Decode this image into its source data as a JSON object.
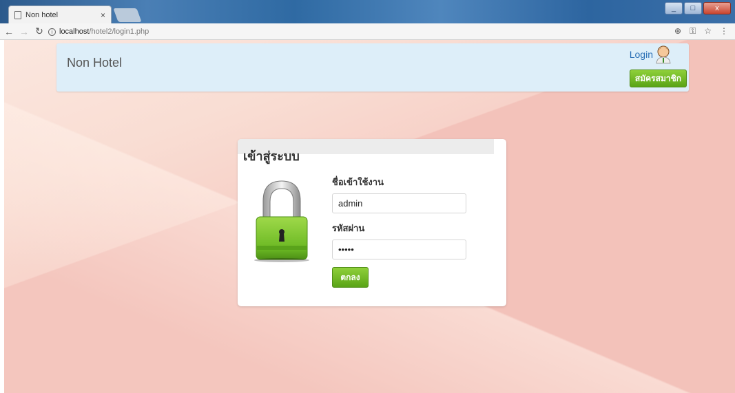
{
  "browser": {
    "tab_title": "Non hotel",
    "tab_close": "×",
    "url_host": "localhost",
    "url_path": "/hotel2/login1.php",
    "window_buttons": [
      "_",
      "□",
      "x"
    ],
    "toolbar_icons": [
      "zoom-icon",
      "key-icon",
      "star-icon",
      "menu-icon"
    ]
  },
  "header": {
    "brand": "Non Hotel",
    "login_label": "Login",
    "register_label": "สมัครสมาชิก"
  },
  "login_card": {
    "title": "เข้าสู่ระบบ",
    "username_label": "ชื่อเข้าใช้งาน",
    "username_value": "admin",
    "password_label": "รหัสผ่าน",
    "password_value": "•••••",
    "submit_label": "ตกลง"
  },
  "colors": {
    "header_bg": "#ddeef9",
    "button_green": "#6cb824",
    "link_blue": "#2a6fb5",
    "page_bg": "#f3c2ba"
  }
}
